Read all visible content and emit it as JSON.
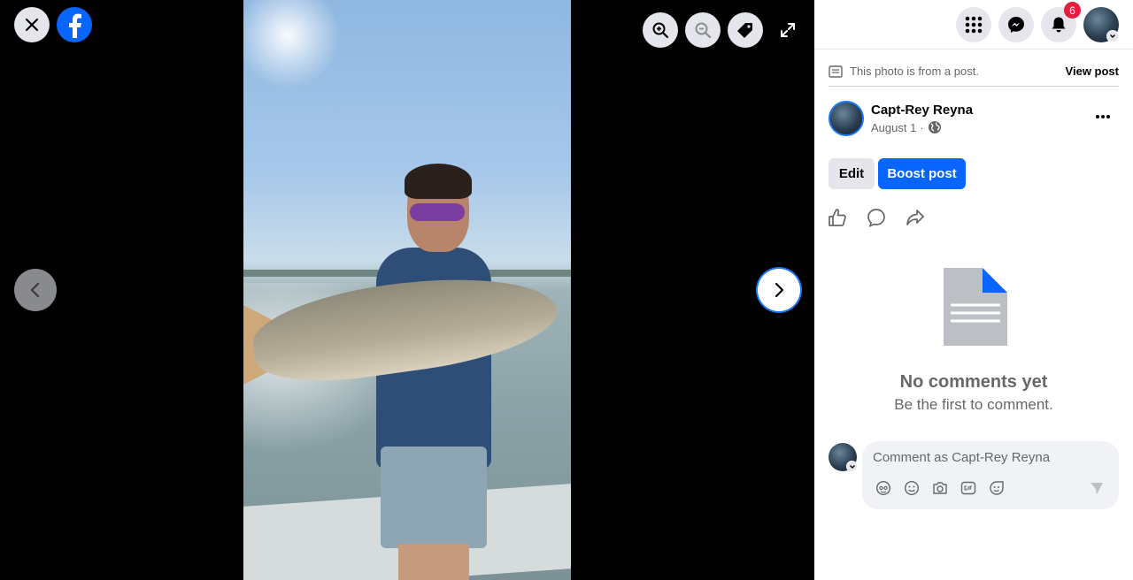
{
  "viewer": {
    "close_icon": "close-icon",
    "logo": "facebook-logo",
    "zoom_in_icon": "zoom-in-icon",
    "zoom_out_icon": "zoom-out-icon",
    "tag_icon": "tag-icon",
    "fullscreen_icon": "fullscreen-icon",
    "prev_icon": "chevron-left-icon",
    "next_icon": "chevron-right-icon"
  },
  "topbar": {
    "menu_icon": "menu-grid-icon",
    "messenger_icon": "messenger-icon",
    "notifications_icon": "bell-icon",
    "notifications_count": "6",
    "brand_color": "#0866ff",
    "badge_color": "#e41e3f"
  },
  "post": {
    "source_text": "This photo is from a post.",
    "view_post_label": "View post",
    "author": "Capt-Rey Reyna",
    "date": "August 1",
    "separator": "·",
    "audience_icon": "globe-icon",
    "edit_label": "Edit",
    "boost_label": "Boost post"
  },
  "actions": {
    "like_icon": "like-icon",
    "comment_icon": "comment-icon",
    "share_icon": "share-icon"
  },
  "comments": {
    "empty_title": "No comments yet",
    "empty_subtitle": "Be the first to comment.",
    "input_placeholder": "Comment as Capt-Rey Reyna",
    "tools": [
      "avatar-sticker-icon",
      "emoji-icon",
      "camera-icon",
      "gif-icon",
      "sticker-icon"
    ],
    "send_icon": "send-icon"
  }
}
